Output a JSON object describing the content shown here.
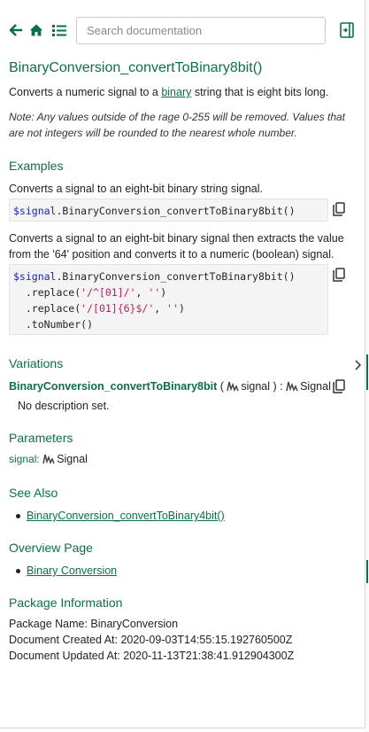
{
  "toolbar": {
    "search_placeholder": "Search documentation"
  },
  "doc": {
    "title": "BinaryConversion_convertToBinary8bit()",
    "description_pre": "Converts a numeric signal to a ",
    "description_link": "binary",
    "description_post": " string that is eight bits long.",
    "note": "Note: Any values outside of the rage 0-255 will be removed. Values that are not integers will be rounded to the nearest whole number."
  },
  "examples": {
    "heading": "Examples",
    "ex1": {
      "description": "Converts a signal to an eight-bit binary string signal.",
      "code_signal": "$signal",
      "code_rest": ".BinaryConversion_convertToBinary8bit()"
    },
    "ex2": {
      "description": "Converts a signal to an eight-bit binary signal then extracts the value from the '64' position and converts it to a numeric (boolean) signal.",
      "line1_signal": "$signal",
      "line1_rest": ".BinaryConversion_convertToBinary8bit()",
      "line2_pre": "  .replace(",
      "line2_str1": "'/^[01]/'",
      "line2_mid": ", ",
      "line2_str2": "''",
      "line2_post": ")",
      "line3_pre": "  .replace(",
      "line3_str1": "'/[01]{6}$/'",
      "line3_mid": ", ",
      "line3_str2": "''",
      "line3_post": ")",
      "line4": "  .toNumber()"
    }
  },
  "variations": {
    "heading": "Variations",
    "name": "BinaryConversion_convertToBinary8bit",
    "open_paren": " ( ",
    "param": "signal",
    "close_paren": " ) : ",
    "return_type": "Signal",
    "description": "No description set."
  },
  "parameters": {
    "heading": "Parameters",
    "name": "signal:",
    "type": "Signal"
  },
  "see_also": {
    "heading": "See Also",
    "items": [
      "BinaryConversion_convertToBinary4bit()"
    ]
  },
  "overview": {
    "heading": "Overview Page",
    "items": [
      "Binary Conversion"
    ]
  },
  "package": {
    "heading": "Package Information",
    "name_line": "Package Name: BinaryConversion",
    "created_line": "Document Created At: 2020-09-03T14:55:15.192760500Z",
    "updated_line": "Document Updated At: 2020-11-13T21:38:41.912904300Z"
  },
  "colors": {
    "accent": "#0b6e4f",
    "code_signal": "#1b1bc8",
    "code_string": "#c41a5c"
  },
  "icons": [
    "back-arrow-icon",
    "home-icon",
    "list-icon",
    "dock-panel-icon",
    "copy-icon",
    "signal-wave-icon",
    "chevron-right-icon"
  ]
}
